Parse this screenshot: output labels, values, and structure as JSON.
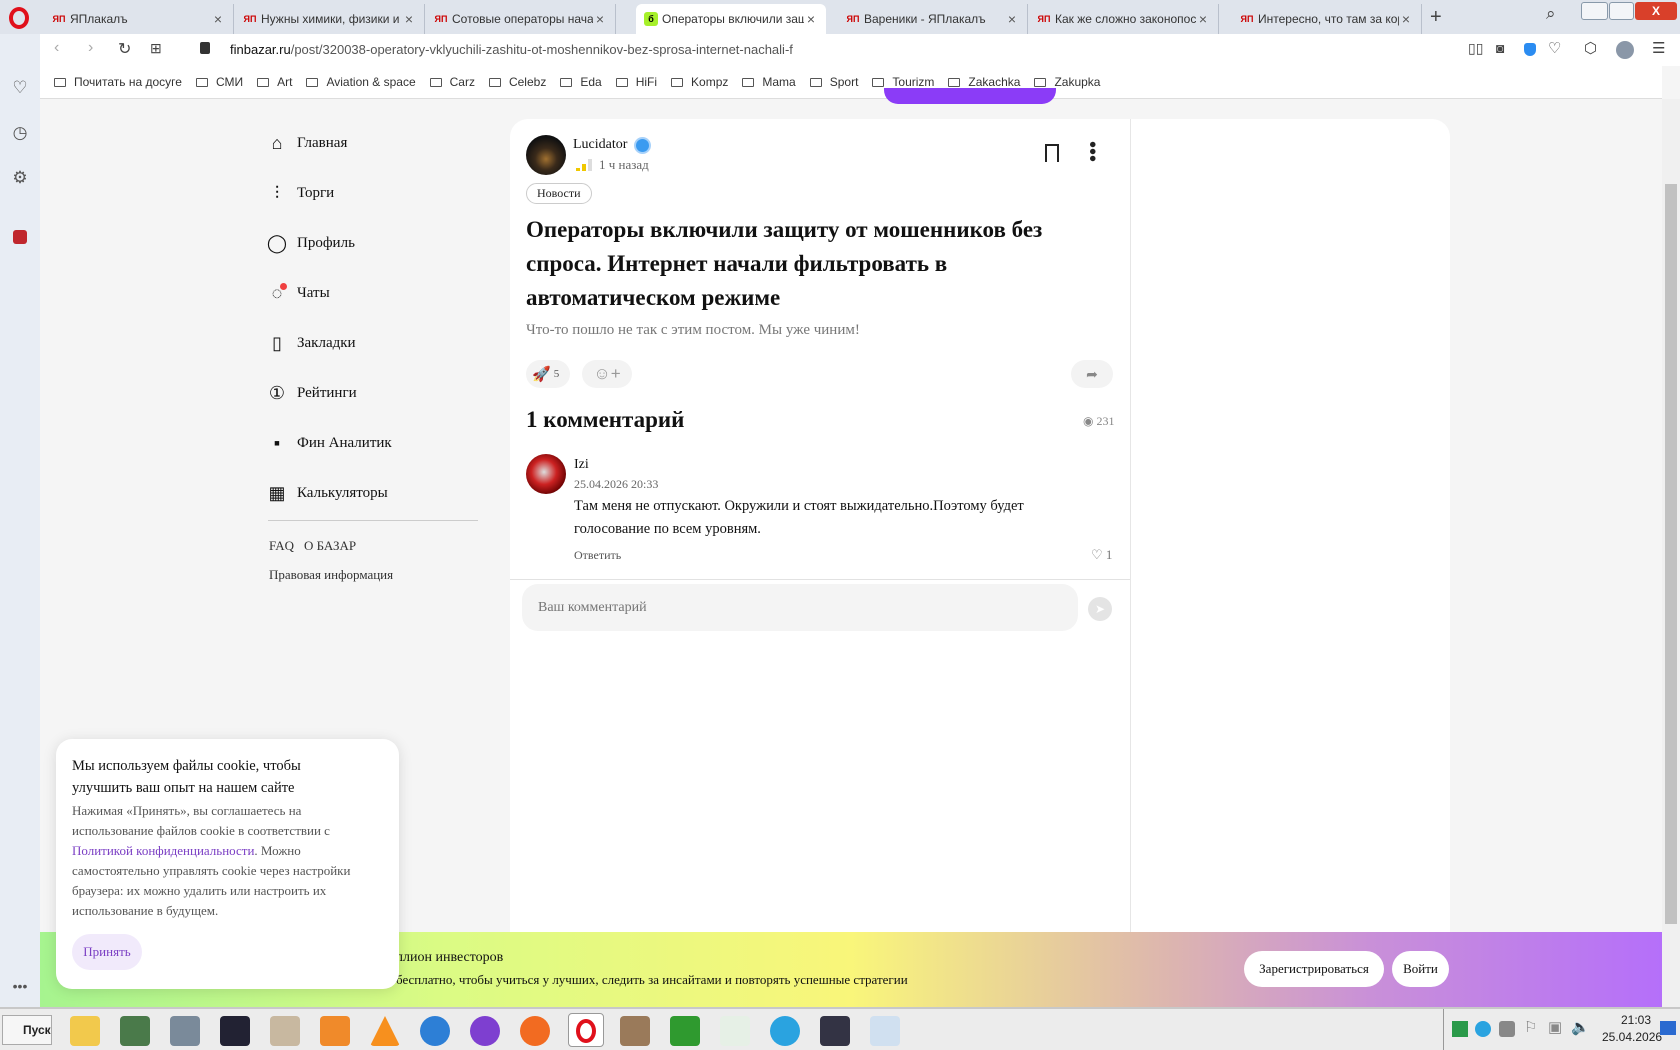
{
  "browser": {
    "tabs": [
      {
        "label": "ЯПлакалъ",
        "active": false
      },
      {
        "label": "Нужны химики, физики и",
        "active": false
      },
      {
        "label": "Сотовые операторы нача",
        "active": false
      },
      {
        "label": "Операторы включили защ",
        "active": true
      },
      {
        "label": "Вареники - ЯПлакалъ",
        "active": false
      },
      {
        "label": "Как же сложно законопос",
        "active": false
      },
      {
        "label": "Интересно, что там за кор",
        "active": false
      }
    ],
    "url_domain": "finbazar.ru",
    "url_path": "/post/320038-operatory-vklyuchili-zashitu-ot-moshennikov-bez-sprosa-internet-nachali-f",
    "bookmarks": [
      "Почитать на досуге",
      "СМИ",
      "Art",
      "Aviation & space",
      "Carz",
      "Celebz",
      "Eda",
      "HiFi",
      "Kompz",
      "Mama",
      "Sport",
      "Tourizm",
      "Zakachka",
      "Zakupka"
    ]
  },
  "nav": {
    "items": [
      {
        "label": "Главная",
        "icon": "home-icon",
        "glyph": "⌂"
      },
      {
        "label": "Торги",
        "icon": "trading-icon",
        "glyph": "⫶"
      },
      {
        "label": "Профиль",
        "icon": "profile-icon",
        "glyph": "◯"
      },
      {
        "label": "Чаты",
        "icon": "chat-icon",
        "glyph": "◌"
      },
      {
        "label": "Закладки",
        "icon": "bookmark-icon",
        "glyph": "▯"
      },
      {
        "label": "Рейтинги",
        "icon": "rating-icon",
        "glyph": "①"
      },
      {
        "label": "Фин Аналитик",
        "icon": "analytics-icon",
        "glyph": "▪"
      },
      {
        "label": "Калькуляторы",
        "icon": "calculator-icon",
        "glyph": "▦"
      }
    ],
    "faq": "FAQ",
    "about": "О БАЗАР",
    "legal": "Правовая информация"
  },
  "post": {
    "author": "Lucidator",
    "time": "1 ч назад",
    "tag": "Новости",
    "title": "Операторы включили защиту от мошенников без спроса. Интернет начали фильтровать в автоматическом режиме",
    "error_text": "Что-то пошло не так с этим постом. Мы уже чиним!",
    "reaction_count": "5",
    "comments_heading": "1 комментарий",
    "views": "231"
  },
  "comment": {
    "author": "Izi",
    "date": "25.04.2026 20:33",
    "text": "Там меня не отпускают. Окружили и стоят выжидательно.Поэтому будет голосование по всем уровням.",
    "reply": "Ответить",
    "likes": "1"
  },
  "comment_input": {
    "placeholder": "Ваш комментарий"
  },
  "cookie": {
    "title": "Мы используем файлы cookie, чтобы улучшить ваш опыт на нашем сайте",
    "text_before": "Нажимая «Принять», вы соглашаетесь на использование файлов cookie в соответствии с ",
    "link": "Политикой конфиденциальности",
    "text_after": ". Можно самостоятельно управлять cookie через настройки браузера: их можно удалить или настроить их использование в будущем.",
    "accept": "Принять"
  },
  "banner": {
    "title": "ллион инвесторов",
    "subtitle": "бесплатно, чтобы учиться у лучших, следить за инсайтами и повторять успешные стратегии",
    "register": "Зарегистрироваться",
    "login": "Войти"
  },
  "taskbar": {
    "start": "Пуск",
    "time": "21:03",
    "date": "25.04.2026"
  },
  "colors": {
    "accent": "#8b3cf7",
    "link": "#7b3fc4"
  }
}
